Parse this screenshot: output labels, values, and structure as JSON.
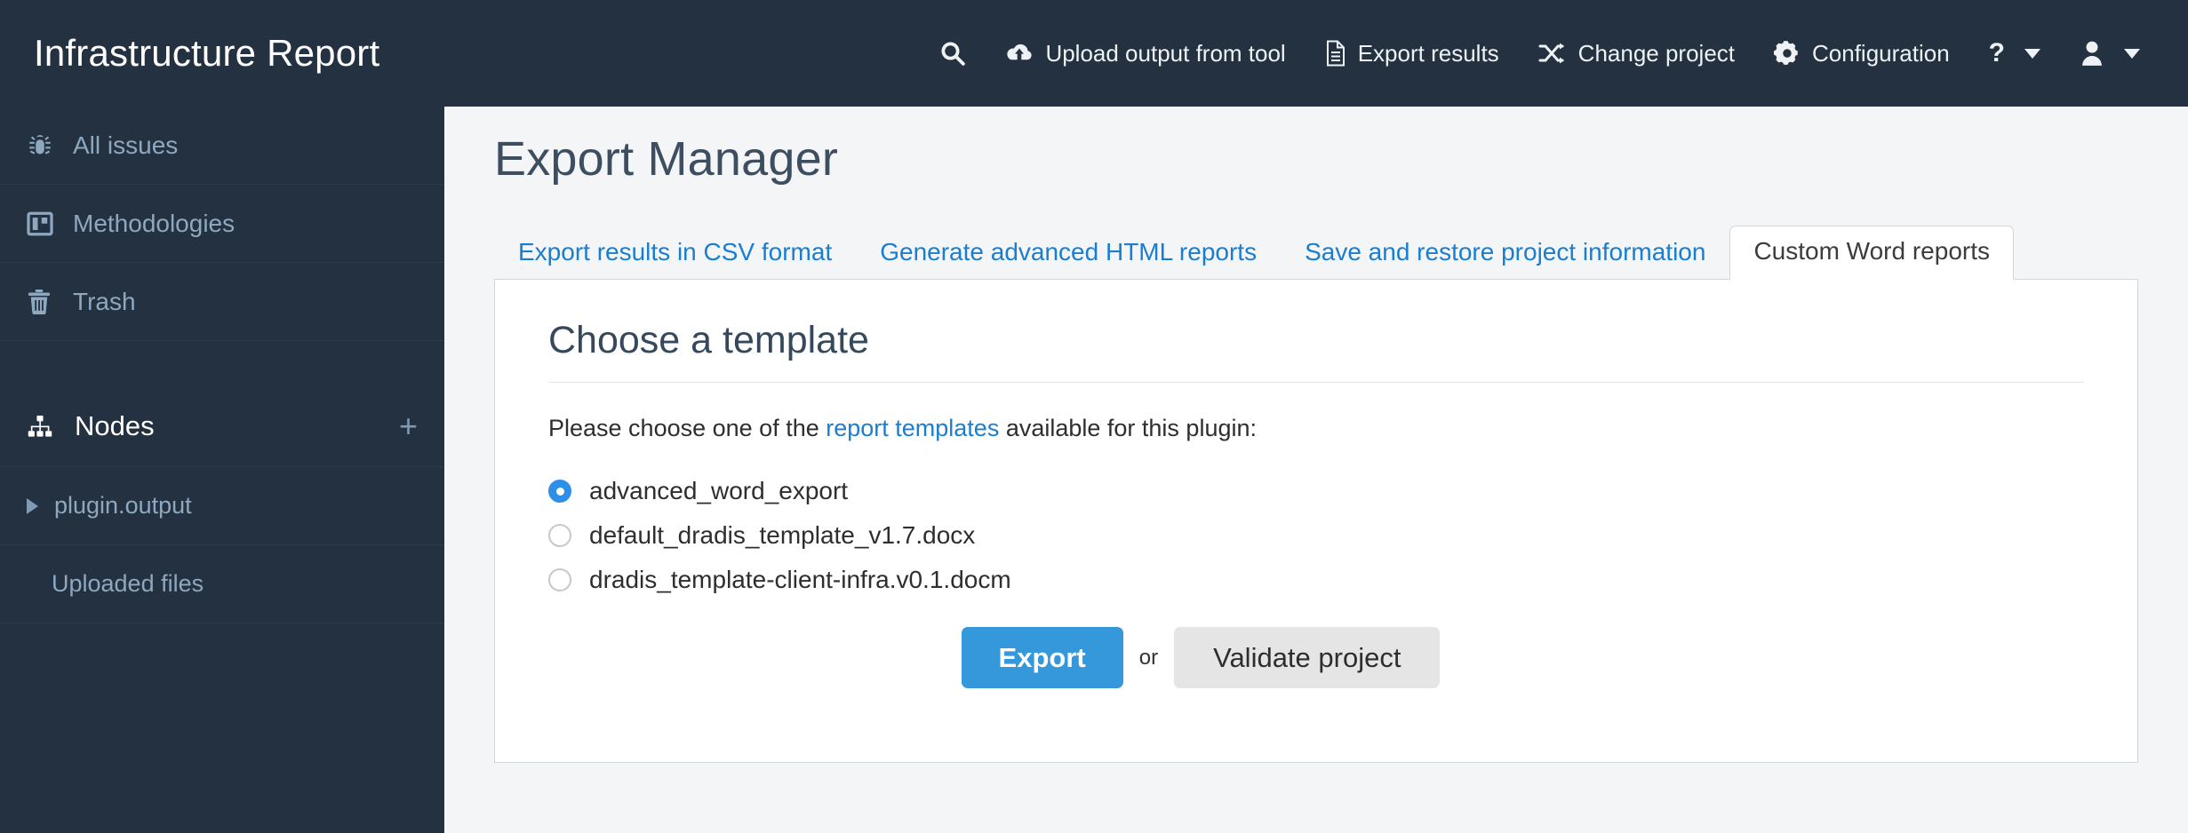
{
  "header": {
    "brand": "Infrastructure Report",
    "nav": [
      {
        "id": "search",
        "icon": "search-icon",
        "label": ""
      },
      {
        "id": "upload",
        "icon": "cloud-upload-icon",
        "label": "Upload output from tool"
      },
      {
        "id": "export",
        "icon": "document-icon",
        "label": "Export results"
      },
      {
        "id": "change-project",
        "icon": "shuffle-icon",
        "label": "Change project"
      },
      {
        "id": "configuration",
        "icon": "gear-icon",
        "label": "Configuration"
      },
      {
        "id": "help",
        "icon": "question-mark-icon",
        "label": "?"
      },
      {
        "id": "account",
        "icon": "user-icon",
        "label": ""
      }
    ]
  },
  "sidebar": {
    "items": [
      {
        "icon": "bug-icon",
        "label": "All issues"
      },
      {
        "icon": "board-icon",
        "label": "Methodologies"
      },
      {
        "icon": "trash-icon",
        "label": "Trash"
      }
    ],
    "nodes_header": {
      "icon": "sitemap-icon",
      "label": "Nodes",
      "add_label": "+"
    },
    "nodes": [
      {
        "label": "plugin.output",
        "expanded": false
      }
    ],
    "sub_items": [
      {
        "label": "Uploaded files"
      }
    ]
  },
  "main": {
    "page_title": "Export Manager",
    "tabs": [
      {
        "label": "Export results in CSV format",
        "active": false
      },
      {
        "label": "Generate advanced HTML reports",
        "active": false
      },
      {
        "label": "Save and restore project information",
        "active": false
      },
      {
        "label": "Custom Word reports",
        "active": true
      }
    ],
    "card": {
      "heading": "Choose a template",
      "lead_before": "Please choose one of the ",
      "lead_link": "report templates",
      "lead_after": " available for this plugin:",
      "templates": [
        {
          "label": "advanced_word_export",
          "selected": true
        },
        {
          "label": "default_dradis_template_v1.7.docx",
          "selected": false
        },
        {
          "label": "dradis_template-client-infra.v0.1.docm",
          "selected": false
        }
      ],
      "export_button": "Export",
      "or_text": "or",
      "validate_button": "Validate project"
    }
  },
  "colors": {
    "topbar_bg": "#243140",
    "sidebar_bg": "#243140",
    "page_bg": "#f4f5f7",
    "link_blue": "#1a7ed0",
    "accent_blue": "#3498db",
    "radio_on": "#2d8fe8",
    "sidebar_text": "#8ea8c0",
    "title_text": "#3d4e60"
  }
}
